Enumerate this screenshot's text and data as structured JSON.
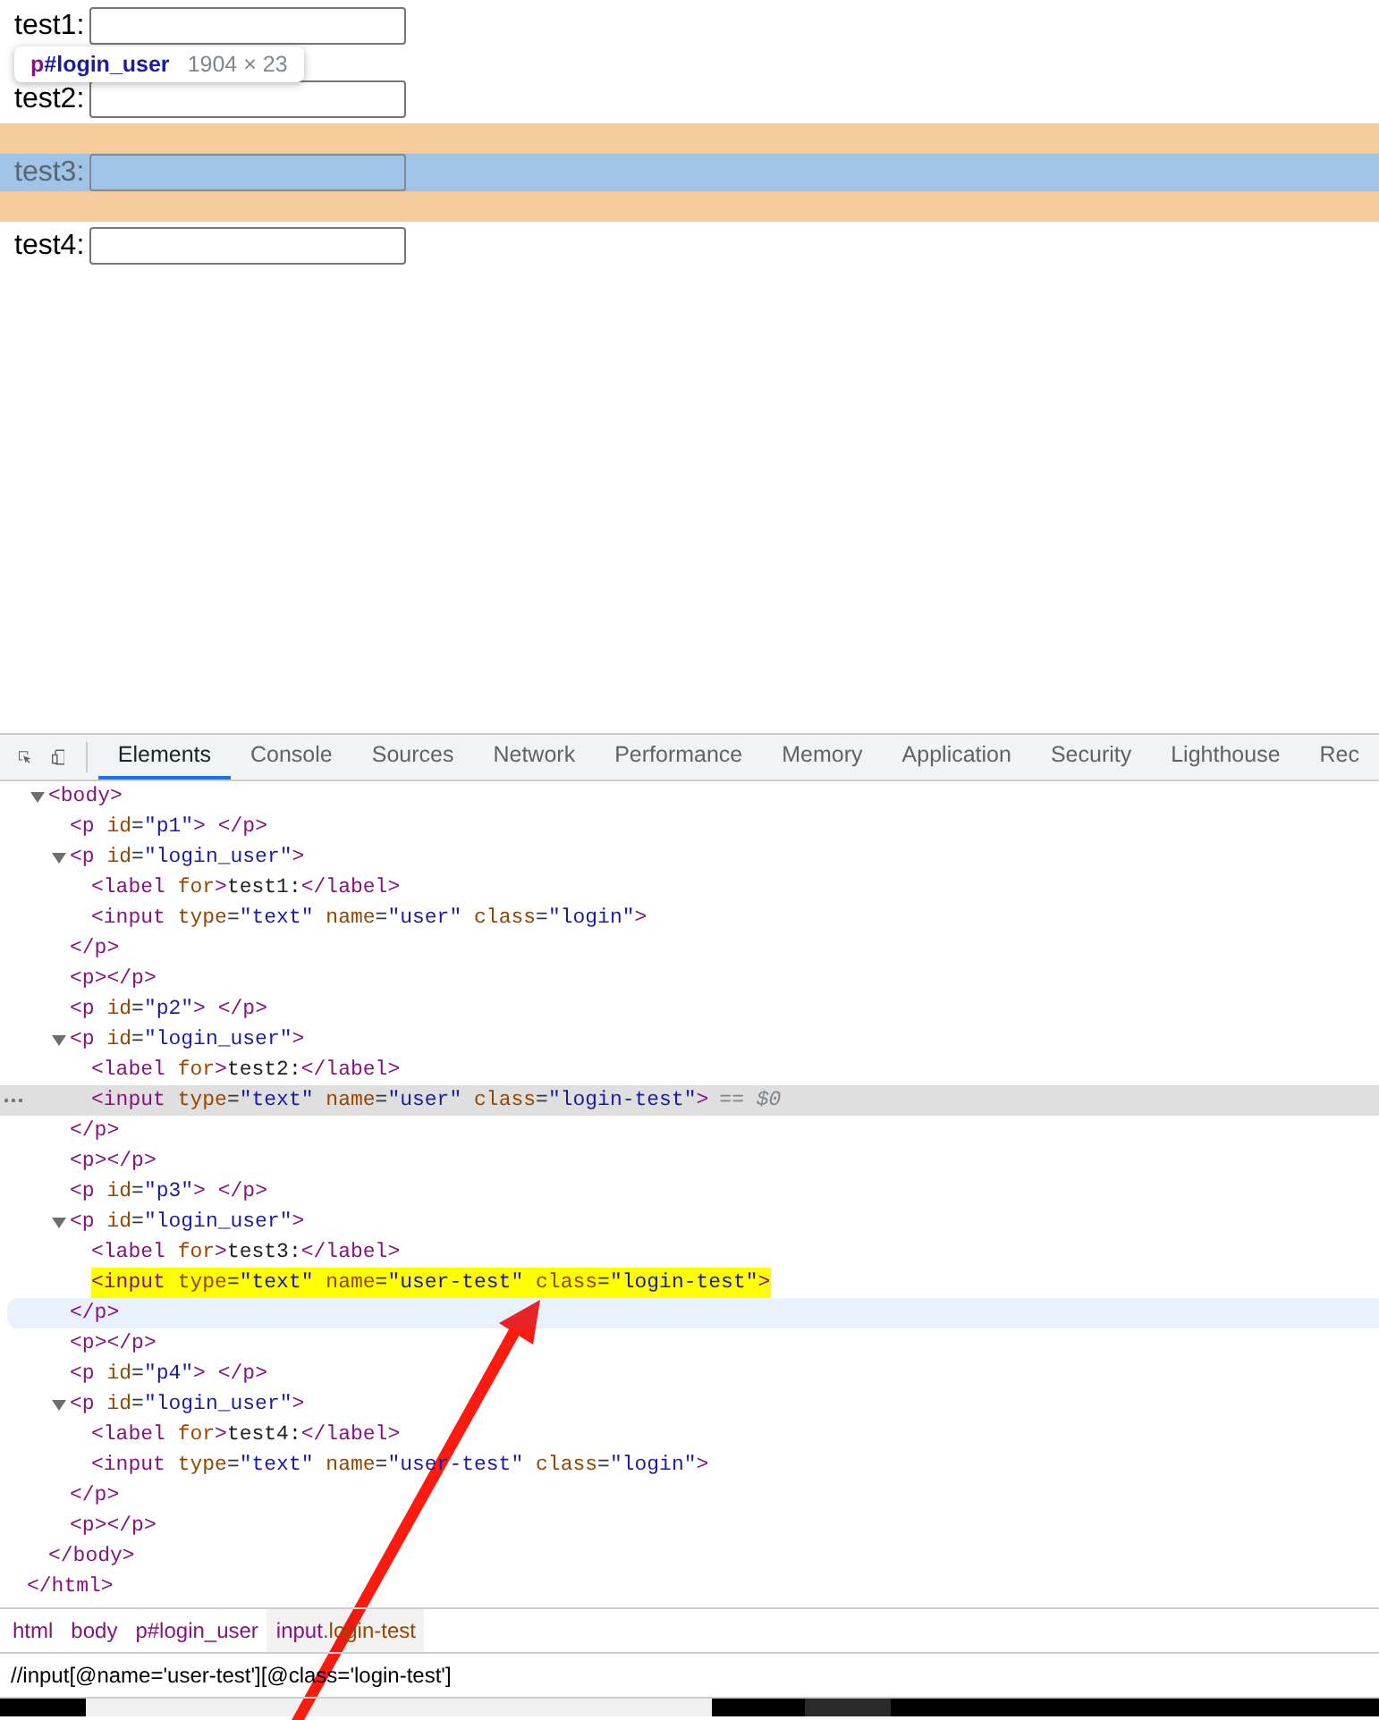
{
  "page": {
    "rows": [
      {
        "label": "test1:",
        "inspected": false
      },
      {
        "label": "test2:",
        "inspected": false
      },
      {
        "label": "test3:",
        "inspected": true
      },
      {
        "label": "test4:",
        "inspected": false
      }
    ],
    "tooltip": {
      "tag": "p",
      "id": "#login_user",
      "size": "1904 × 23"
    }
  },
  "devtools": {
    "tabs": [
      {
        "label": "Elements",
        "selected": true
      },
      {
        "label": "Console",
        "selected": false
      },
      {
        "label": "Sources",
        "selected": false
      },
      {
        "label": "Network",
        "selected": false
      },
      {
        "label": "Performance",
        "selected": false
      },
      {
        "label": "Memory",
        "selected": false
      },
      {
        "label": "Application",
        "selected": false
      },
      {
        "label": "Security",
        "selected": false
      },
      {
        "label": "Lighthouse",
        "selected": false
      },
      {
        "label": "Rec",
        "selected": false
      }
    ],
    "dom_tree": [
      {
        "close": "</html>",
        "hovered": false,
        "children": [
          {
            "open": "<body>",
            "close": "</body>",
            "expanded": true,
            "hovered": false,
            "children": [
              {
                "text": "<p id=\"p1\"> </p>",
                "selected": false,
                "highlighted": false
              },
              {
                "open": "<p id=\"login_user\">",
                "close": "</p>",
                "expanded": true,
                "hovered": false,
                "children": [
                  {
                    "text": "<label for>test1:</label>",
                    "selected": false,
                    "highlighted": false
                  },
                  {
                    "text": "<input type=\"text\" name=\"user\" class=\"login\">",
                    "selected": false,
                    "highlighted": false
                  }
                ]
              },
              {
                "text": "<p></p>",
                "selected": false,
                "highlighted": false
              },
              {
                "text": "<p id=\"p2\"> </p>",
                "selected": false,
                "highlighted": false
              },
              {
                "open": "<p id=\"login_user\">",
                "close": "</p>",
                "expanded": true,
                "hovered": false,
                "children": [
                  {
                    "text": "<label for>test2:</label>",
                    "selected": false,
                    "highlighted": false
                  },
                  {
                    "text": "<input type=\"text\" name=\"user\" class=\"login-test\">",
                    "selected": true,
                    "highlighted": false,
                    "suffix": "== $0"
                  }
                ]
              },
              {
                "text": "<p></p>",
                "selected": false,
                "highlighted": false
              },
              {
                "text": "<p id=\"p3\"> </p>",
                "selected": false,
                "highlighted": false
              },
              {
                "open": "<p id=\"login_user\">",
                "close": "</p>",
                "expanded": true,
                "hovered": true,
                "children": [
                  {
                    "text": "<label for>test3:</label>",
                    "selected": false,
                    "highlighted": false
                  },
                  {
                    "text": "<input type=\"text\" name=\"user-test\" class=\"login-test\">",
                    "selected": false,
                    "highlighted": true
                  }
                ]
              },
              {
                "text": "<p></p>",
                "selected": false,
                "highlighted": false
              },
              {
                "text": "<p id=\"p4\"> </p>",
                "selected": false,
                "highlighted": false
              },
              {
                "open": "<p id=\"login_user\">",
                "close": "</p>",
                "expanded": true,
                "hovered": false,
                "children": [
                  {
                    "text": "<label for>test4:</label>",
                    "selected": false,
                    "highlighted": false
                  },
                  {
                    "text": "<input type=\"text\" name=\"user-test\" class=\"login\">",
                    "selected": false,
                    "highlighted": false
                  }
                ]
              },
              {
                "text": "<p></p>",
                "selected": false,
                "highlighted": false
              }
            ]
          }
        ]
      }
    ],
    "breadcrumbs": [
      {
        "tag": "html",
        "selected": false
      },
      {
        "tag": "body",
        "selected": false
      },
      {
        "tag": "p#login_user",
        "selected": false
      },
      {
        "tag": "input",
        "suffix": ".login-test",
        "selected": true
      }
    ],
    "search": {
      "value": "//input[@name='user-test'][@class='login-test']"
    }
  }
}
